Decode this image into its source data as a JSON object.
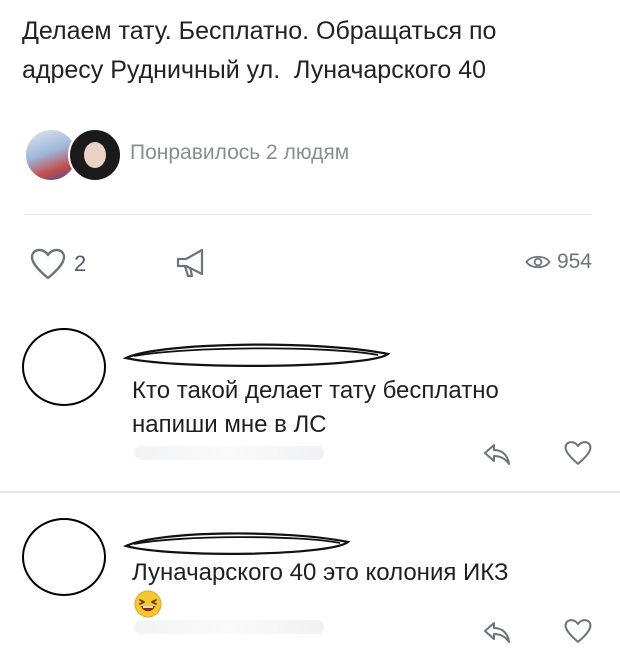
{
  "post": {
    "text_lines": [
      "Делаем тату. Бесплатно. Обращаться по",
      "адресу Рудничный ул.  Луначарского 40"
    ],
    "liked_by_text": "Понравилось 2 людям"
  },
  "actions": {
    "like_count": "2",
    "views_count": "954"
  },
  "comments": [
    {
      "lines": [
        "Кто такой делает тату бесплатно",
        "напиши мне в ЛС"
      ]
    },
    {
      "text": "Луначарского 40 это колония ИКЗ",
      "emoji": "laughing-face"
    }
  ],
  "colors": {
    "text": "#222222",
    "muted": "#8a8e94",
    "icon": "#6e7378",
    "divider": "#e3e4e8"
  }
}
